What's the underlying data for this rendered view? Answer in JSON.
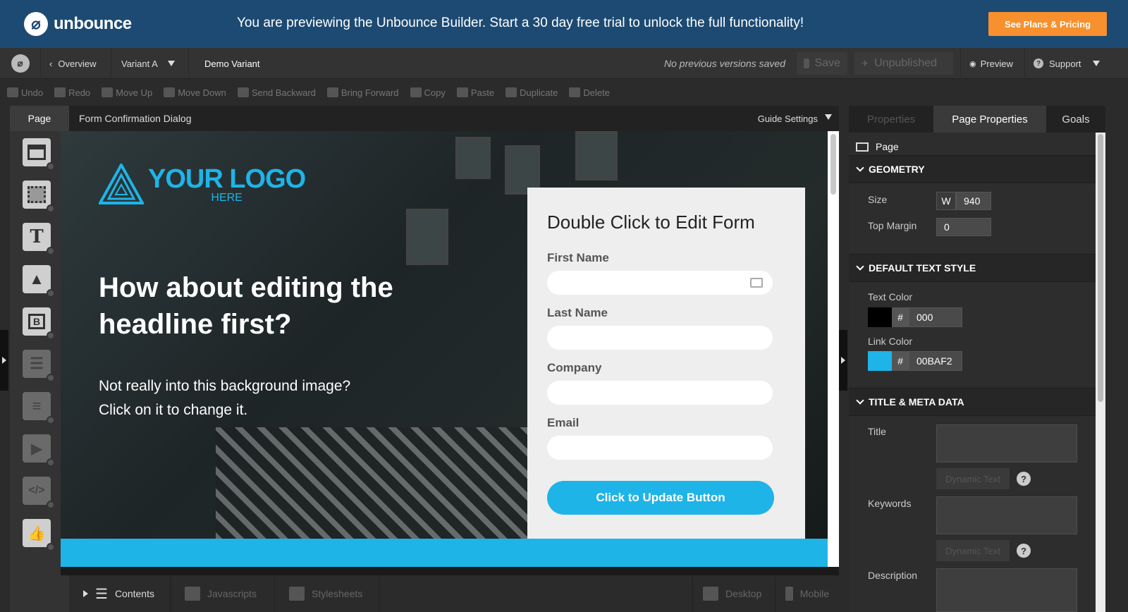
{
  "banner": {
    "brand": "unbounce",
    "message": "You are previewing the Unbounce Builder. Start a 30 day free trial to unlock the full functionality!",
    "cta": "See Plans & Pricing"
  },
  "toolbar": {
    "overview": "Overview",
    "variant": "Variant A",
    "variant_name": "Demo Variant",
    "versions": "No previous versions saved",
    "save": "Save",
    "unpublished": "Unpublished",
    "preview": "Preview",
    "support": "Support"
  },
  "editbar": [
    {
      "label": "Undo"
    },
    {
      "label": "Redo"
    },
    {
      "label": "Move Up"
    },
    {
      "label": "Move Down"
    },
    {
      "label": "Send Backward"
    },
    {
      "label": "Bring Forward"
    },
    {
      "label": "Copy"
    },
    {
      "label": "Paste"
    },
    {
      "label": "Duplicate"
    },
    {
      "label": "Delete"
    }
  ],
  "page_tab": "Page",
  "canvas_header": {
    "title": "Form Confirmation Dialog",
    "guide": "Guide Settings"
  },
  "hero": {
    "logo_main": "YOUR LOGO",
    "logo_sub": "HERE",
    "headline": "How about editing the headline first?",
    "subline": "Not really into this background image? Click on it to change it."
  },
  "form": {
    "title": "Double Click to Edit Form",
    "fields": [
      {
        "label": "First Name"
      },
      {
        "label": "Last Name"
      },
      {
        "label": "Company"
      },
      {
        "label": "Email"
      }
    ],
    "button": "Click to Update Button"
  },
  "bottombar": {
    "contents": "Contents",
    "javascripts": "Javascripts",
    "stylesheets": "Stylesheets",
    "desktop": "Desktop",
    "mobile": "Mobile"
  },
  "panel": {
    "tabs": [
      "Properties",
      "Page Properties",
      "Goals"
    ],
    "page_label": "Page",
    "geometry": {
      "heading": "GEOMETRY",
      "size_label": "Size",
      "w_label": "W",
      "width": "940",
      "top_margin_label": "Top Margin",
      "top_margin": "0"
    },
    "text_style": {
      "heading": "DEFAULT TEXT STYLE",
      "text_color_label": "Text Color",
      "text_color": "000",
      "text_color_hex": "#000000",
      "link_color_label": "Link Color",
      "link_color": "00BAF2",
      "link_color_hex": "#00BAF2",
      "hash": "#"
    },
    "meta": {
      "heading": "TITLE & META DATA",
      "title_label": "Title",
      "keywords_label": "Keywords",
      "description_label": "Description",
      "dynamic_text": "Dynamic Text",
      "help": "?"
    }
  },
  "colors": {
    "banner": "#1c4a73",
    "cta": "#f7902d",
    "accent": "#1eb4e8"
  }
}
